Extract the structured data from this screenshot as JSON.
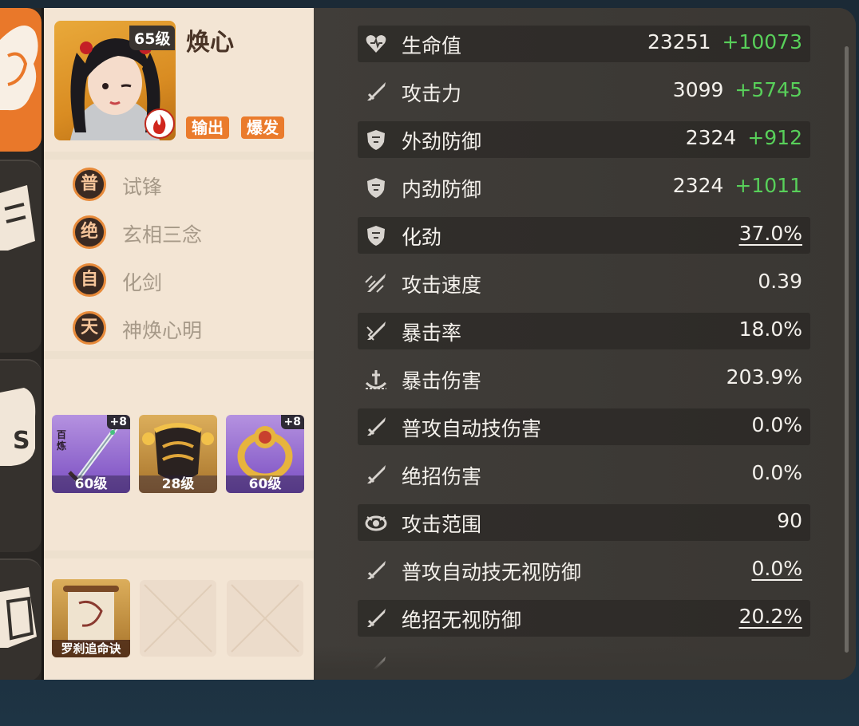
{
  "character": {
    "level": "65级",
    "name": "焕心",
    "tags": [
      "输出",
      "爆发"
    ]
  },
  "skills": [
    {
      "badge": "普",
      "name": "试锋"
    },
    {
      "badge": "绝",
      "name": "玄相三念"
    },
    {
      "badge": "自",
      "name": "化剑"
    },
    {
      "badge": "天",
      "name": "神焕心明"
    }
  ],
  "equipment": [
    {
      "level": "60级",
      "enhance": "+8",
      "rarity": "purple",
      "icon": "sword-icon",
      "inscription": "百炼"
    },
    {
      "level": "28级",
      "enhance": "",
      "rarity": "gold",
      "icon": "armor-icon"
    },
    {
      "level": "60级",
      "enhance": "+8",
      "rarity": "purple",
      "icon": "ring-icon"
    }
  ],
  "manuals": [
    {
      "name": "罗刹追命诀",
      "icon": "scroll-icon"
    },
    {
      "name": "",
      "icon": "empty-slot"
    },
    {
      "name": "",
      "icon": "empty-slot"
    }
  ],
  "stats": [
    {
      "label": "生命值",
      "value": "23251",
      "bonus": "+10073",
      "icon": "heart-icon"
    },
    {
      "label": "攻击力",
      "value": "3099",
      "bonus": "+5745",
      "icon": "sword-icon"
    },
    {
      "label": "外劲防御",
      "value": "2324",
      "bonus": "+912",
      "icon": "shield-icon"
    },
    {
      "label": "内劲防御",
      "value": "2324",
      "bonus": "+1011",
      "icon": "shield-icon"
    },
    {
      "label": "化劲",
      "value": "37.0%",
      "bonus": "",
      "icon": "shield-icon",
      "underline": true
    },
    {
      "label": "攻击速度",
      "value": "0.39",
      "bonus": "",
      "icon": "swift-sword-icon"
    },
    {
      "label": "暴击率",
      "value": "18.0%",
      "bonus": "",
      "icon": "crit-icon"
    },
    {
      "label": "暴击伤害",
      "value": "203.9%",
      "bonus": "",
      "icon": "anchor-icon"
    },
    {
      "label": "普攻自动技伤害",
      "value": "0.0%",
      "bonus": "",
      "icon": "sword-icon"
    },
    {
      "label": "绝招伤害",
      "value": "0.0%",
      "bonus": "",
      "icon": "sword-icon"
    },
    {
      "label": "攻击范围",
      "value": "90",
      "bonus": "",
      "icon": "range-icon"
    },
    {
      "label": "普攻自动技无视防御",
      "value": "0.0%",
      "bonus": "",
      "icon": "sword-icon",
      "underline": true
    },
    {
      "label": "绝招无视防御",
      "value": "20.2%",
      "bonus": "",
      "icon": "sword-icon",
      "underline": true
    }
  ],
  "colors": {
    "accent": "#ea7b2c",
    "bonus": "#58d05a",
    "panel": "#3e3b37",
    "card": "#f4e7d7"
  }
}
